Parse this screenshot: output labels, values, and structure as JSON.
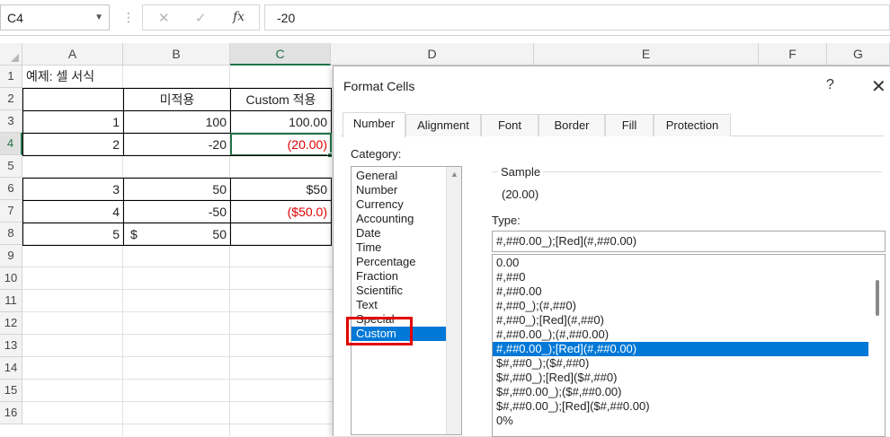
{
  "formula_bar": {
    "name_box": "C4",
    "value": "-20",
    "cancel_icon": "✕",
    "enter_icon": "✓",
    "fx_label": "fx"
  },
  "columns": [
    "A",
    "B",
    "C",
    "D",
    "E",
    "F",
    "G"
  ],
  "rows": [
    "1",
    "2",
    "3",
    "4",
    "5",
    "6",
    "7",
    "8",
    "9",
    "10",
    "11",
    "12",
    "13",
    "14",
    "15",
    "16"
  ],
  "cells": {
    "a1": "예제: 셀 서식",
    "b2": "미적용",
    "c2": "Custom 적용",
    "a3": "1",
    "b3": "100",
    "c3": "100.00",
    "a4": "2",
    "b4": "-20",
    "c4": "(20.00)",
    "a6": "3",
    "b6": "50",
    "c6": "$50",
    "a7": "4",
    "b7": "-50",
    "c7": "($50.0)",
    "a8": "5",
    "b8_symbol": "$",
    "b8": "50"
  },
  "dialog": {
    "title": "Format Cells",
    "help": "?",
    "close": "✕",
    "tabs": [
      "Number",
      "Alignment",
      "Font",
      "Border",
      "Fill",
      "Protection"
    ],
    "active_tab": "Number",
    "category_label": "Category:",
    "categories": [
      "General",
      "Number",
      "Currency",
      "Accounting",
      "Date",
      "Time",
      "Percentage",
      "Fraction",
      "Scientific",
      "Text",
      "Special",
      "Custom"
    ],
    "selected_category": "Custom",
    "sample_label": "Sample",
    "sample_value": "(20.00)",
    "type_label": "Type:",
    "type_value": "#,##0.00_);[Red](#,##0.00)",
    "type_list": [
      "0.00",
      "#,##0",
      "#,##0.00",
      "#,##0_);(#,##0)",
      "#,##0_);[Red](#,##0)",
      "#,##0.00_);(#,##0.00)",
      "#,##0.00_);[Red](#,##0.00)",
      "$#,##0_);($#,##0)",
      "$#,##0_);[Red]($#,##0)",
      "$#,##0.00_);($#,##0.00)",
      "$#,##0.00_);[Red]($#,##0.00)",
      "0%"
    ],
    "selected_type_index": 6
  },
  "colors": {
    "accent_green": "#217346",
    "selection_blue": "#0078d7",
    "negative_red": "#e00000"
  }
}
